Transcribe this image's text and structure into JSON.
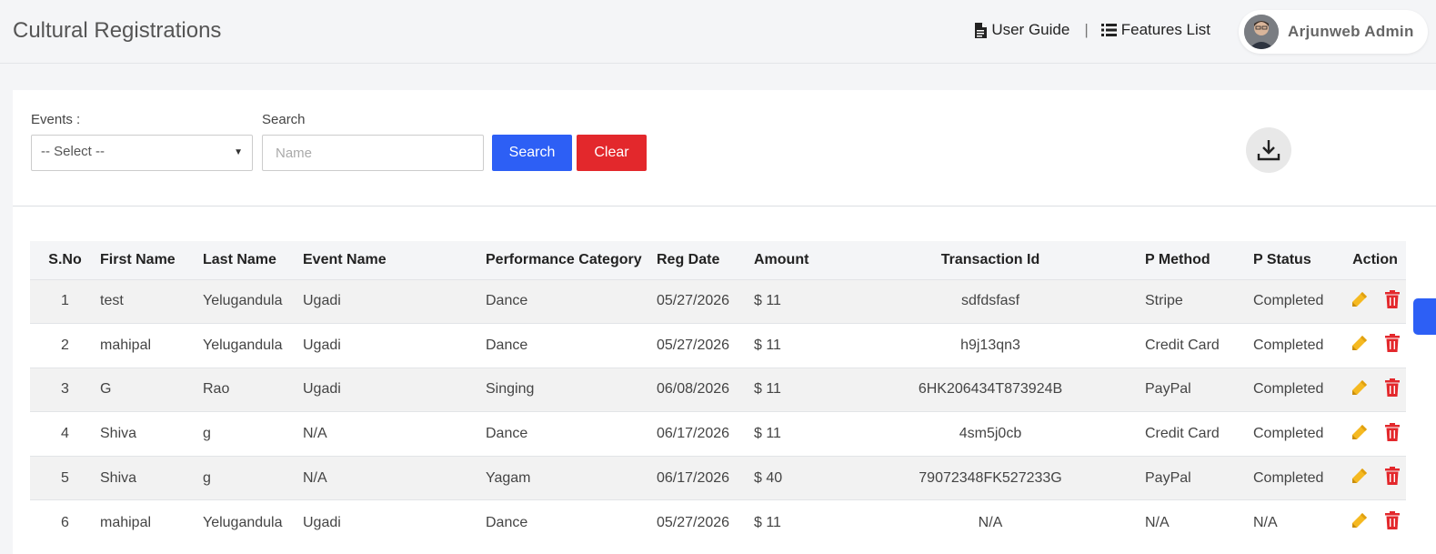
{
  "header": {
    "title": "Cultural Registrations",
    "user_guide": "User Guide",
    "separator": "|",
    "features_list": "Features List",
    "user_name": "Arjunweb Admin"
  },
  "filters": {
    "events_label": "Events :",
    "events_value": "-- Select --",
    "search_label": "Search",
    "search_placeholder": "Name",
    "search_button": "Search",
    "clear_button": "Clear"
  },
  "table": {
    "columns": [
      "S.No",
      "First Name",
      "Last Name",
      "Event Name",
      "Performance Category",
      "Reg Date",
      "Amount",
      "Transaction Id",
      "P Method",
      "P Status",
      "Action"
    ],
    "rows": [
      {
        "sno": "1",
        "first": "test",
        "last": "Yelugandula",
        "event": "Ugadi",
        "category": "Dance",
        "date": "05/27/2026",
        "amount": "$ 11",
        "txn": "sdfdsfasf",
        "method": "Stripe",
        "status": "Completed"
      },
      {
        "sno": "2",
        "first": "mahipal",
        "last": "Yelugandula",
        "event": "Ugadi",
        "category": "Dance",
        "date": "05/27/2026",
        "amount": "$ 11",
        "txn": "h9j13qn3",
        "method": "Credit Card",
        "status": "Completed"
      },
      {
        "sno": "3",
        "first": "G",
        "last": "Rao",
        "event": "Ugadi",
        "category": "Singing",
        "date": "06/08/2026",
        "amount": "$ 11",
        "txn": "6HK206434T873924B",
        "method": "PayPal",
        "status": "Completed"
      },
      {
        "sno": "4",
        "first": "Shiva",
        "last": "g",
        "event": "N/A",
        "category": "Dance",
        "date": "06/17/2026",
        "amount": "$ 11",
        "txn": "4sm5j0cb",
        "method": "Credit Card",
        "status": "Completed"
      },
      {
        "sno": "5",
        "first": "Shiva",
        "last": "g",
        "event": "N/A",
        "category": "Yagam",
        "date": "06/17/2026",
        "amount": "$ 40",
        "txn": "79072348FK527233G",
        "method": "PayPal",
        "status": "Completed"
      },
      {
        "sno": "6",
        "first": "mahipal",
        "last": "Yelugandula",
        "event": "Ugadi",
        "category": "Dance",
        "date": "05/27/2026",
        "amount": "$ 11",
        "txn": "N/A",
        "method": "N/A",
        "status": "N/A"
      }
    ]
  },
  "icons": {
    "user_guide": "document-icon",
    "features_list": "list-icon",
    "download": "download-icon",
    "edit": "pencil-icon",
    "delete": "trash-icon"
  },
  "colors": {
    "primary": "#2d5ff5",
    "danger": "#e3282c",
    "edit": "#f5b921",
    "delete": "#e3282c"
  }
}
